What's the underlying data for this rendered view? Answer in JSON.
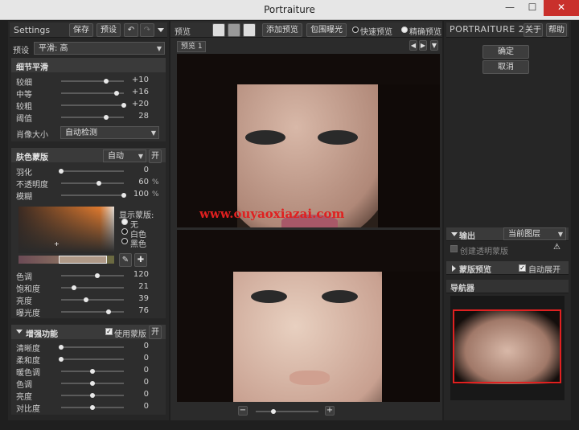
{
  "window": {
    "title": "Portraiture",
    "minimize": "—",
    "maximize": "☐",
    "close": "✕"
  },
  "left": {
    "header": {
      "title": "Settings",
      "save": "保存",
      "preset_btn": "预设"
    },
    "preset": {
      "label": "预设",
      "value": "平滑: 高"
    },
    "detail": {
      "title": "细节平滑",
      "rows": [
        {
          "label": "较细",
          "value": "+10",
          "pos": 0.72
        },
        {
          "label": "中等",
          "value": "+16",
          "pos": 0.88
        },
        {
          "label": "较粗",
          "value": "+20",
          "pos": 1.0
        },
        {
          "label": "阈值",
          "value": "28",
          "pos": 0.72
        }
      ],
      "portrait_size": {
        "label": "肖像大小",
        "value": "自动检测"
      }
    },
    "mask": {
      "title": "肤色蒙版",
      "mode": "自动",
      "on_label": "开",
      "rows": [
        {
          "label": "羽化",
          "value": "0",
          "unit": "",
          "pos": 0.0
        },
        {
          "label": "不透明度",
          "value": "60",
          "unit": "%",
          "pos": 0.6
        },
        {
          "label": "模糊",
          "value": "100",
          "unit": "%",
          "pos": 1.0
        }
      ],
      "show_mask": "显示蒙版:",
      "radios": [
        {
          "label": "无",
          "on": true
        },
        {
          "label": "白色",
          "on": false
        },
        {
          "label": "黑色",
          "on": false
        }
      ],
      "tone_rows": [
        {
          "label": "色调",
          "value": "120",
          "pos": 0.58
        },
        {
          "label": "饱和度",
          "value": "21",
          "pos": 0.2
        },
        {
          "label": "亮度",
          "value": "39",
          "pos": 0.4
        },
        {
          "label": "曝光度",
          "value": "76",
          "pos": 0.76
        }
      ]
    },
    "enhance": {
      "title": "增强功能",
      "use_mask": "使用蒙版",
      "on_label": "开",
      "rows": [
        {
          "label": "清晰度",
          "value": "0",
          "pos": 0.0
        },
        {
          "label": "柔和度",
          "value": "0",
          "pos": 0.0
        },
        {
          "label": "暖色调",
          "value": "0",
          "pos": 0.5
        },
        {
          "label": "色调",
          "value": "0",
          "pos": 0.5
        },
        {
          "label": "亮度",
          "value": "0",
          "pos": 0.5
        },
        {
          "label": "对比度",
          "value": "0",
          "pos": 0.5
        }
      ]
    }
  },
  "center": {
    "toolbar": {
      "preview": "预览",
      "add_preview": "添加预览",
      "bracket": "包围曝光",
      "fast": "快速预览",
      "precise": "精确预览"
    },
    "tab": "预览 1",
    "watermark": "www.ouyaoxiazai.com",
    "zoom": {
      "minus": "−",
      "plus": "+"
    }
  },
  "right": {
    "title": "PORTRAITURE 2",
    "about": "关于",
    "help": "帮助",
    "ok": "确定",
    "cancel": "取消",
    "output": {
      "title": "输出",
      "value": "当前图层",
      "create_mask": "创建透明蒙版"
    },
    "mask_preview": {
      "title": "蒙版预览",
      "auto_expand": "自动展开"
    },
    "navigator": {
      "title": "导航器"
    }
  },
  "colors": {
    "accent": "#e07a2e",
    "nav_frame": "#e02020"
  }
}
